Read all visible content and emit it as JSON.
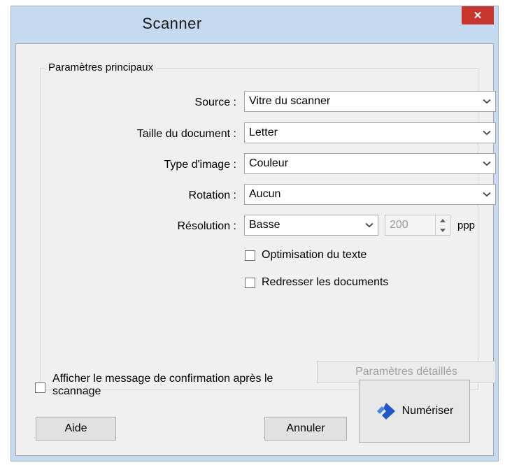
{
  "window": {
    "title": "Scanner",
    "close_symbol": "✕"
  },
  "main_settings": {
    "group_label": "Paramètres principaux",
    "source": {
      "label": "Source :",
      "value": "Vitre du scanner"
    },
    "document_size": {
      "label": "Taille du document :",
      "value": "Letter"
    },
    "image_type": {
      "label": "Type d'image :",
      "value": "Couleur"
    },
    "rotation": {
      "label": "Rotation :",
      "value": "Aucun"
    },
    "resolution": {
      "label": "Résolution :",
      "value": "Basse",
      "dpi": "200",
      "unit": "ppp"
    },
    "text_enhancement": {
      "label": "Optimisation du texte",
      "checked": false
    },
    "correct_skew": {
      "label": "Redresser les documents",
      "checked": false
    },
    "detailed_settings_label": "Paramètres détaillés"
  },
  "confirm_message": {
    "line1": "Afficher le message de confirmation après le",
    "line2": "scannage",
    "checked": false
  },
  "buttons": {
    "help": "Aide",
    "cancel": "Annuler",
    "scan": "Numériser"
  },
  "colors": {
    "title_bar": "#c5daf0",
    "close_button": "#c7352c",
    "scan_icon": "#1f57c4"
  }
}
